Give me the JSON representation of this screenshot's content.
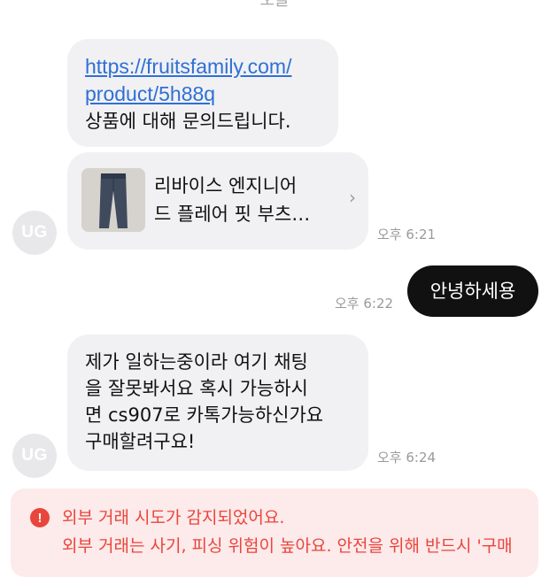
{
  "top_cut_text": "오늘",
  "messages": [
    {
      "sender": "other",
      "link_line1": "https://fruitsfamily.com/",
      "link_line2": "product/5h88q",
      "text": "상품에 대해 문의드립니다."
    },
    {
      "sender": "other",
      "type": "product-card",
      "product_line1": "리바이스 엔지니어",
      "product_line2": "드 플레어 핏 부츠…",
      "time": "오후 6:21",
      "avatar": "UG"
    },
    {
      "sender": "me",
      "text": "안녕하세용",
      "time": "오후 6:22"
    },
    {
      "sender": "other",
      "lines": [
        "제가 일하는중이라 여기 채팅",
        "을 잘못봐서요 혹시 가능하시",
        "면 cs907로 카톡가능하신가요",
        "구매할려구요!"
      ],
      "time": "오후 6:24",
      "avatar": "UG"
    }
  ],
  "alert": {
    "title": "외부 거래 시도가 감지되었어요.",
    "body": "외부 거래는 사기, 피싱 위험이 높아요. 안전을 위해 반드시 '구매",
    "icon": "exclamation-icon",
    "color": "#e8453c"
  }
}
